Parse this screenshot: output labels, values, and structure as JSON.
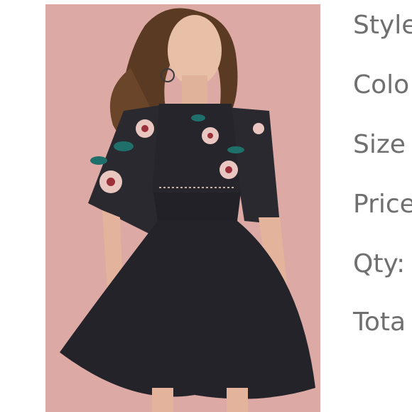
{
  "product_photo": {
    "subject": "woman wearing black embroidered dress",
    "background_color": "#dca9a4",
    "dress_color": "#24232a"
  },
  "details": {
    "style_label": "Style",
    "color_label": "Colo",
    "size_label": "Size",
    "price_label": "Price",
    "qty_label": "Qty:",
    "total_label": "Tota"
  }
}
